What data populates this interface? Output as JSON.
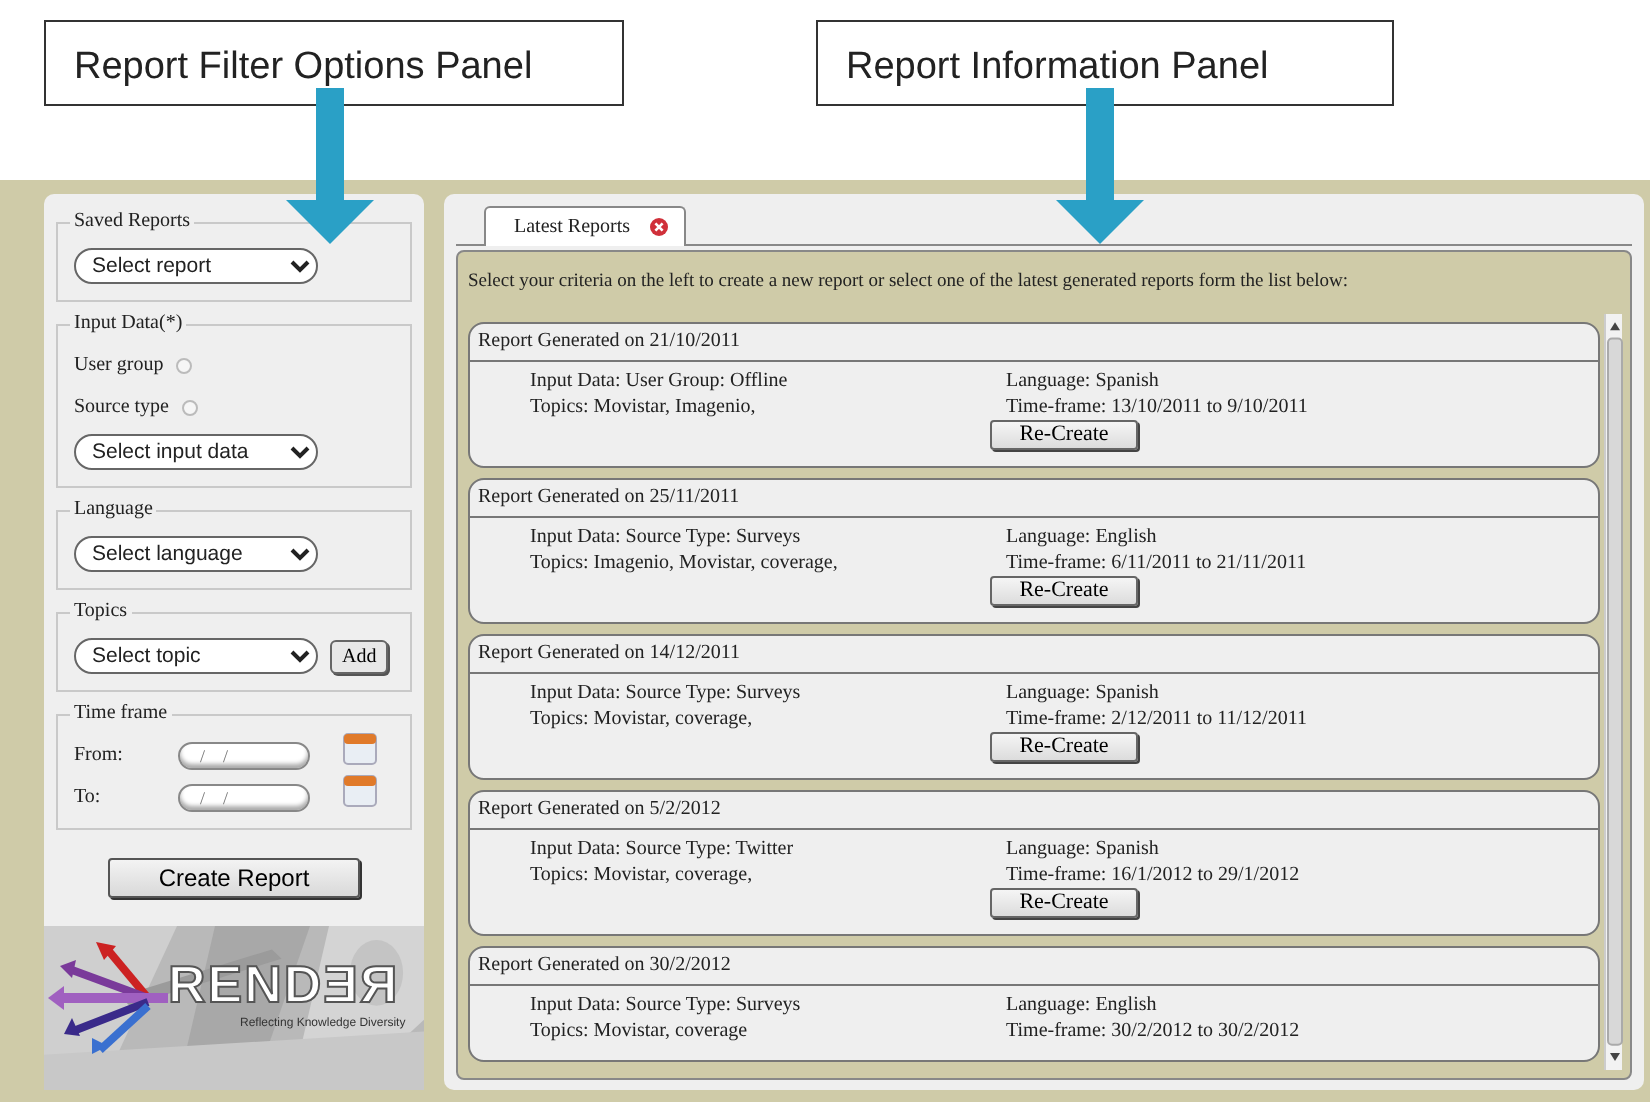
{
  "callouts": [
    {
      "label": "Report Filter Options Panel"
    },
    {
      "label": "Report Information Panel"
    }
  ],
  "filter_panel": {
    "sections": [
      {
        "legend": "Saved Reports",
        "items": [
          {
            "kind": "select",
            "value": "Select report"
          }
        ]
      },
      {
        "legend": "Input Data(*)",
        "items": [
          {
            "kind": "radio",
            "label": "User group",
            "checked": false
          },
          {
            "kind": "radio",
            "label": "Source type",
            "checked": false
          },
          {
            "kind": "select",
            "value": "Select input data"
          }
        ]
      },
      {
        "legend": "Language",
        "items": [
          {
            "kind": "select",
            "value": "Select language"
          }
        ]
      },
      {
        "legend": "Topics",
        "items": [
          {
            "kind": "select",
            "value": "Select topic",
            "button": "Add"
          }
        ]
      },
      {
        "legend": "Time frame",
        "items": [
          {
            "kind": "date",
            "label": "From:",
            "placeholder": "/    /"
          },
          {
            "kind": "date",
            "label": "To:",
            "placeholder": "/    /"
          }
        ]
      }
    ],
    "create_button": "Create Report",
    "logo": {
      "name": "RENDƎЯ",
      "tagline": "Reflecting Knowledge Diversity"
    }
  },
  "info_panel": {
    "tabs": [
      {
        "label": "Latest Reports",
        "selected": true
      }
    ],
    "instructions": "Select your criteria on the left to create a new report or select one of the latest generated reports form the list below:",
    "reports": [
      {
        "title": "Report Generated on 21/10/2011",
        "input_data": "Input Data: User Group: Offline",
        "language": "Language: Spanish",
        "topics": "Topics: Movistar, Imagenio,",
        "time_frame": "Time-frame: 13/10/2011 to 9/10/2011",
        "button": "Re-Create"
      },
      {
        "title": "Report Generated on 25/11/2011",
        "input_data": "Input Data: Source Type: Surveys",
        "language": "Language: English",
        "topics": "Topics: Imagenio, Movistar, coverage,",
        "time_frame": "Time-frame: 6/11/2011 to 21/11/2011",
        "button": "Re-Create"
      },
      {
        "title": "Report Generated on 14/12/2011",
        "input_data": "Input Data: Source Type: Surveys",
        "language": "Language: Spanish",
        "topics": "Topics: Movistar, coverage,",
        "time_frame": "Time-frame: 2/12/2011 to 11/12/2011",
        "button": "Re-Create"
      },
      {
        "title": "Report Generated on 5/2/2012",
        "input_data": "Input Data: Source Type: Twitter",
        "language": "Language: Spanish",
        "topics": "Topics: Movistar, coverage,",
        "time_frame": "Time-frame: 16/1/2012 to 29/1/2012",
        "button": "Re-Create"
      },
      {
        "title": "Report Generated on 30/2/2012",
        "input_data": "Input Data: Source Type: Surveys",
        "language": "Language: English",
        "topics": "Topics: Movistar, coverage",
        "time_frame": "Time-frame: 30/2/2012 to 30/2/2012"
      }
    ]
  }
}
